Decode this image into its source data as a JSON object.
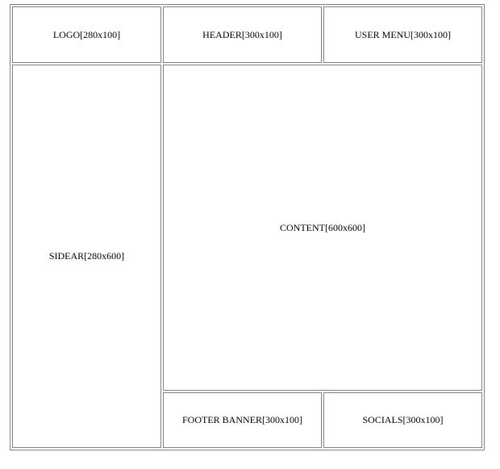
{
  "layout": {
    "logo": "LOGO[280x100]",
    "header": "HEADER[300x100]",
    "user_menu": "USER MENU[300x100]",
    "sidebar": "SIDEAR[280x600]",
    "content": "CONTENT[600x600]",
    "footer_banner": "FOOTER BANNER[300x100]",
    "socials": "SOCIALS[300x100]"
  },
  "colors": {
    "border": "#808080",
    "background": "#ffffff",
    "text": "#000000"
  }
}
